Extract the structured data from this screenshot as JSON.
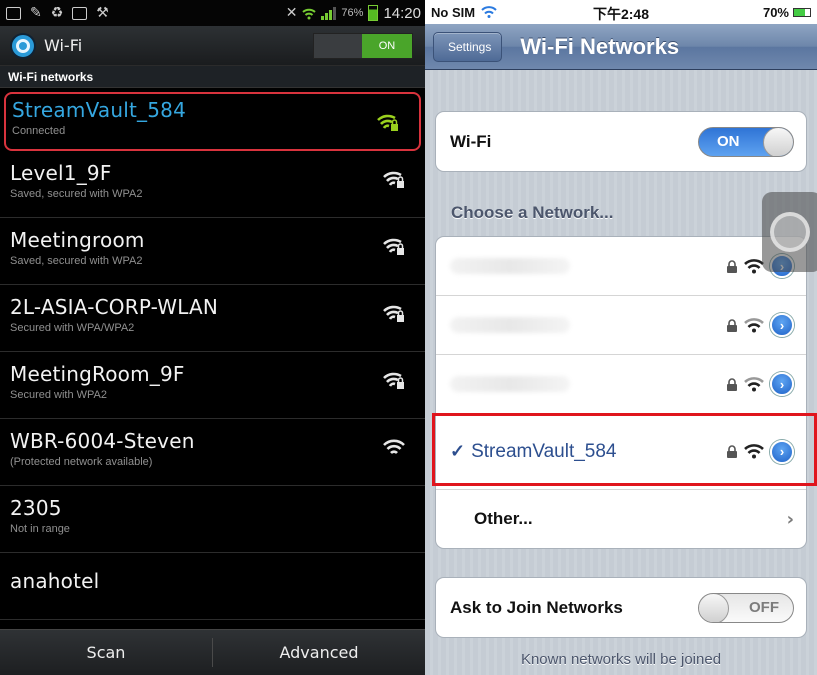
{
  "android": {
    "status": {
      "battery_pct": "76%",
      "time": "14:20"
    },
    "header": {
      "title": "Wi-Fi",
      "toggle_label": "ON"
    },
    "section_label": "Wi-Fi networks",
    "networks": [
      {
        "ssid": "StreamVault_584",
        "status": "Connected",
        "signal_color": "#9bd11e"
      },
      {
        "ssid": "Level1_9F",
        "status": "Saved, secured with WPA2",
        "signal_color": "#e6e6e6"
      },
      {
        "ssid": "Meetingroom",
        "status": "Saved, secured with WPA2",
        "signal_color": "#e6e6e6"
      },
      {
        "ssid": "2L-ASIA-CORP-WLAN",
        "status": "Secured with WPA/WPA2",
        "signal_color": "#e6e6e6"
      },
      {
        "ssid": "MeetingRoom_9F",
        "status": "Secured with WPA2",
        "signal_color": "#e6e6e6"
      },
      {
        "ssid": "WBR-6004-Steven",
        "status": "(Protected network available)",
        "signal_color": "#e6e6e6"
      },
      {
        "ssid": "2305",
        "status": "Not in range",
        "signal_color": ""
      },
      {
        "ssid": "anahotel",
        "status": "",
        "signal_color": ""
      }
    ],
    "bottom": {
      "scan_label": "Scan",
      "advanced_label": "Advanced"
    }
  },
  "ios": {
    "status": {
      "carrier": "No SIM",
      "time": "下午2:48",
      "battery_pct": "70%"
    },
    "nav": {
      "back_label": "Settings",
      "title": "Wi-Fi Networks"
    },
    "wifi_row": {
      "label": "Wi-Fi",
      "toggle_label": "ON"
    },
    "choose_label": "Choose a Network...",
    "networks": [
      {
        "ssid": "",
        "detail_glyph": "›"
      },
      {
        "ssid": "",
        "detail_glyph": "›"
      },
      {
        "ssid": "",
        "detail_glyph": "›"
      },
      {
        "ssid": "StreamVault_584",
        "check": "✓",
        "detail_glyph": "›"
      }
    ],
    "other_label": "Other...",
    "other_chevron": "›",
    "ask_row": {
      "label": "Ask to Join Networks",
      "toggle_label": "OFF"
    },
    "footer_text": "Known networks will be joined"
  },
  "colors": {
    "android_accent": "#35a7e0",
    "highlight_red": "#e0151d",
    "ios_blue": "#2f74d6"
  }
}
